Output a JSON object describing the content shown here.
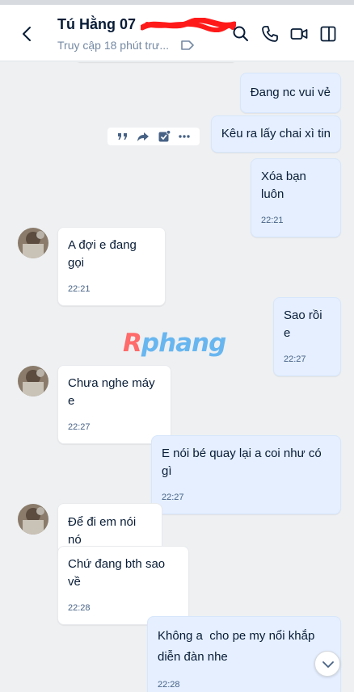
{
  "contact": {
    "name": "Tú Hằng 07",
    "status": "Truy cập 18 phút trư..."
  },
  "header_icons": [
    "back-arrow-icon",
    "search-icon",
    "phone-icon",
    "video-icon",
    "sidebar-toggle-icon",
    "tag-icon"
  ],
  "message_actions": [
    "quote-icon",
    "forward-icon",
    "todo-icon",
    "more-icon"
  ],
  "watermark": {
    "part1": "R",
    "part2": "phang"
  },
  "messages": [
    {
      "sender": "me",
      "text": "Đang nc vui vẻ",
      "time": ""
    },
    {
      "sender": "me",
      "text": "Kêu ra lấy chai xì tin",
      "time": ""
    },
    {
      "sender": "me",
      "text": "Xóa bạn luôn",
      "time": "22:21"
    },
    {
      "sender": "them",
      "text": "A đợi e đang gọi",
      "time": "22:21"
    },
    {
      "sender": "me",
      "text": "Sao rồi e",
      "time": "22:27"
    },
    {
      "sender": "them",
      "text": "Chưa nghe máy e",
      "time": "22:27"
    },
    {
      "sender": "me",
      "text": "E nói bé quay lại a coi như có gì",
      "time": "22:27"
    },
    {
      "sender": "them",
      "text": "Để đi em nói nó",
      "time": ""
    },
    {
      "sender": "them",
      "text": "Chứ đang bth sao về",
      "time": "22:28"
    },
    {
      "sender": "me",
      "text": "Không a  cho pe my nổi khắp diễn đàn nhe",
      "time": "22:28"
    }
  ],
  "colors": {
    "my_bubble": "#e5efff",
    "their_bubble": "#ffffff",
    "background": "#eef0f2",
    "time_text": "#476285"
  }
}
